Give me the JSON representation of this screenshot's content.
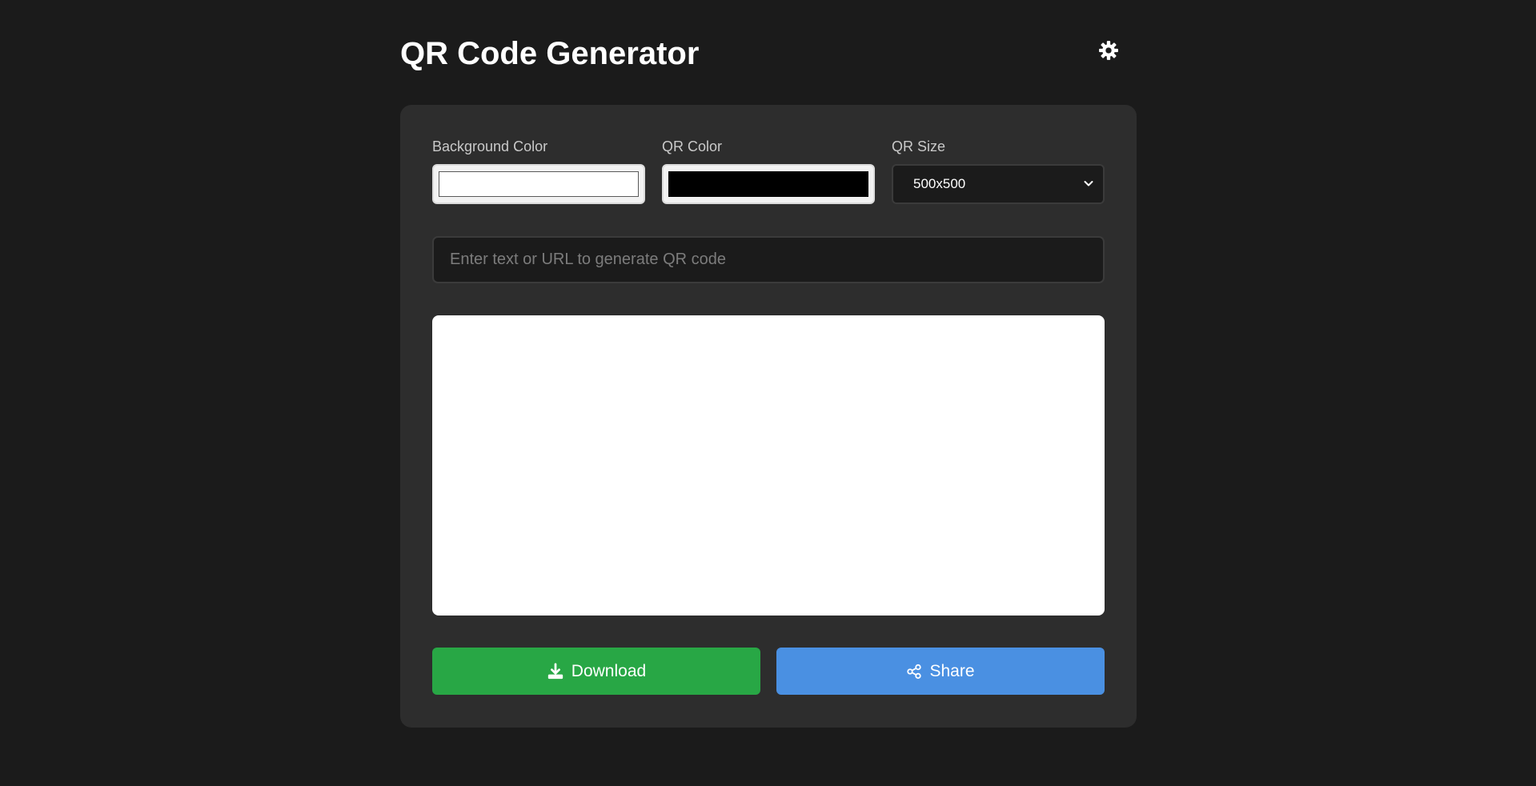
{
  "header": {
    "title": "QR Code Generator",
    "theme_toggle_icon": "gear-icon"
  },
  "controls": {
    "background_color": {
      "label": "Background Color",
      "value": "#ffffff"
    },
    "qr_color": {
      "label": "QR Color",
      "value": "#000000"
    },
    "qr_size": {
      "label": "QR Size",
      "selected": "500x500"
    }
  },
  "input": {
    "placeholder": "Enter text or URL to generate QR code",
    "value": ""
  },
  "actions": {
    "download_label": "Download",
    "download_icon": "download-icon",
    "share_label": "Share",
    "share_icon": "share-icon"
  },
  "colors": {
    "page_background": "#1b1b1b",
    "card_background": "#2d2d2d",
    "download_button": "#28a745",
    "share_button": "#4a90e2"
  }
}
